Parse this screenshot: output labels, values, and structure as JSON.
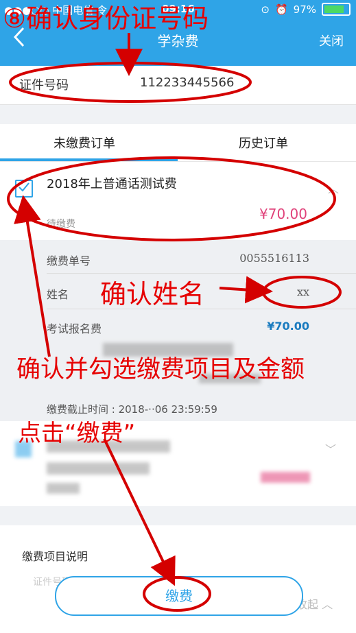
{
  "status_bar": {
    "carrier": "●●●○○ 中国电信 令",
    "time": "09:16",
    "battery": "97%"
  },
  "nav": {
    "back_icon": "chevron-left-icon",
    "title": "学杂费",
    "close": "关闭"
  },
  "id_row": {
    "label": "证件号码",
    "value": "112233445566"
  },
  "tabs": [
    {
      "label": "未缴费订单",
      "active": true
    },
    {
      "label": "历史订单",
      "active": false
    }
  ],
  "order": {
    "title": "2018年上普通话测试费",
    "status": "待缴费",
    "price": "¥70.00",
    "checked": true
  },
  "details": {
    "bill_no_label": "缴费单号",
    "bill_no_value": "0055516113",
    "name_label": "姓名",
    "name_value": "xx",
    "fee_label": "考试报名费",
    "fee_value": "¥70.00",
    "deadline": "缴费截止时间 : 2018-··06 23:59:59"
  },
  "explain": {
    "title": "缴费项目说明",
    "hint": "证件号码:请输入身份证",
    "collapse": "收起"
  },
  "pay_button": "缴费",
  "annotations": {
    "a1": "⑧确认身份证号码",
    "a2": "确认姓名",
    "a3": "确认并勾选缴费项目及金额",
    "a4": "点击“缴费”"
  },
  "colors": {
    "primary": "#2fa4e7",
    "price": "#e0427a",
    "annotation": "#e60000"
  }
}
